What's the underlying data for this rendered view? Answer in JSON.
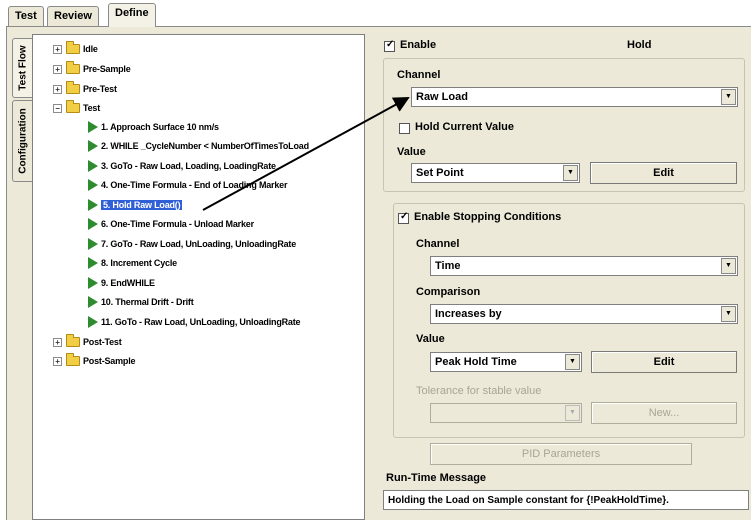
{
  "tabs": [
    "Test",
    "Review",
    "Define"
  ],
  "side_tabs": [
    "Test Flow",
    "Configuration"
  ],
  "tree": {
    "groups": [
      "Idle",
      "Pre-Sample",
      "Pre-Test",
      "Test",
      "Post-Test",
      "Post-Sample"
    ],
    "steps": [
      "1. Approach Surface  10 nm/s",
      "2. WHILE _CycleNumber < NumberOfTimesToLoad",
      "3.   GoTo - Raw Load, Loading, LoadingRate",
      "4.   One-Time Formula - End of Loading Marker",
      "5.   Hold Raw Load()",
      "6.   One-Time Formula - Unload Marker",
      "7.   GoTo - Raw Load, UnLoading, UnloadingRate",
      "8.   Increment Cycle",
      "9. EndWHILE",
      "10. Thermal Drift - Drift",
      "11. GoTo - Raw Load, UnLoading, UnloadingRate"
    ]
  },
  "segment": {
    "enable_label": "Enable",
    "title": "Hold",
    "channel_label": "Channel",
    "channel_value": "Raw Load",
    "hold_current_label": "Hold Current Value",
    "value_label": "Value",
    "value_value": "Set Point",
    "edit_label": "Edit"
  },
  "stopping": {
    "enable_label": "Enable Stopping Conditions",
    "channel_label": "Channel",
    "channel_value": "Time",
    "comparison_label": "Comparison",
    "comparison_value": "Increases by",
    "value_label": "Value",
    "value_value": "Peak Hold Time",
    "edit_label": "Edit",
    "tolerance_label": "Tolerance for stable value",
    "tolerance_value": "",
    "new_label": "New..."
  },
  "pid_label": "PID Parameters",
  "runtime": {
    "label": "Run-Time Message",
    "value": "Holding the Load on Sample constant for {!PeakHoldTime}."
  },
  "colors": {
    "selection": "#2f5fd6",
    "step_arrow": "#2d8c2d",
    "folder": "#f2cd46",
    "panel": "#ece9d8"
  }
}
